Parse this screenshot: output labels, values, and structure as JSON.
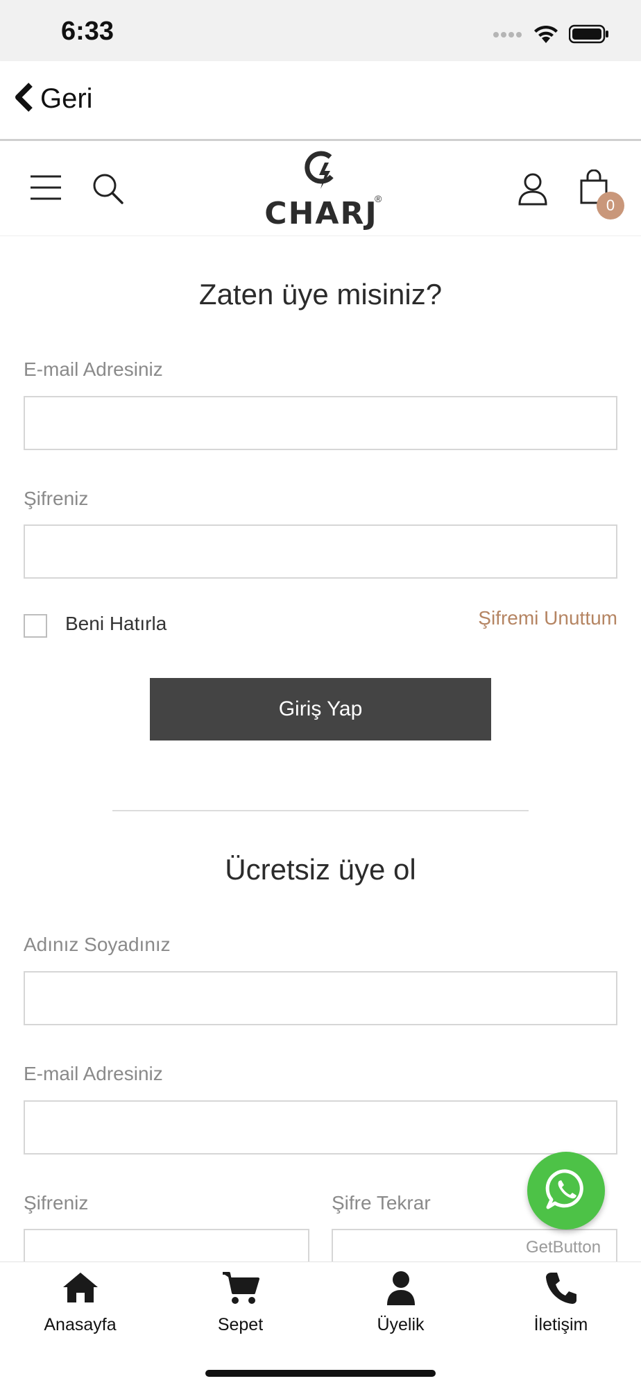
{
  "status_bar": {
    "time": "6:33"
  },
  "nav": {
    "back_label": "Geri"
  },
  "header": {
    "brand": "CHARJ",
    "cart_count": "0"
  },
  "login": {
    "title": "Zaten üye misiniz?",
    "email_label": "E-mail Adresiniz",
    "password_label": "Şifreniz",
    "remember_label": "Beni Hatırla",
    "forgot_label": "Şifremi Unuttum",
    "submit_label": "Giriş Yap"
  },
  "register": {
    "title": "Ücretsiz üye ol",
    "name_label": "Adınız Soyadınız",
    "email_label": "E-mail Adresiniz",
    "password_label": "Şifreniz",
    "password_repeat_label": "Şifre Tekrar"
  },
  "whatsapp": {
    "caption": "GetButton"
  },
  "tabbar": {
    "items": [
      {
        "label": "Anasayfa",
        "icon": "home-icon"
      },
      {
        "label": "Sepet",
        "icon": "cart-icon"
      },
      {
        "label": "Üyelik",
        "icon": "user-icon"
      },
      {
        "label": "İletişim",
        "icon": "phone-icon"
      }
    ]
  }
}
